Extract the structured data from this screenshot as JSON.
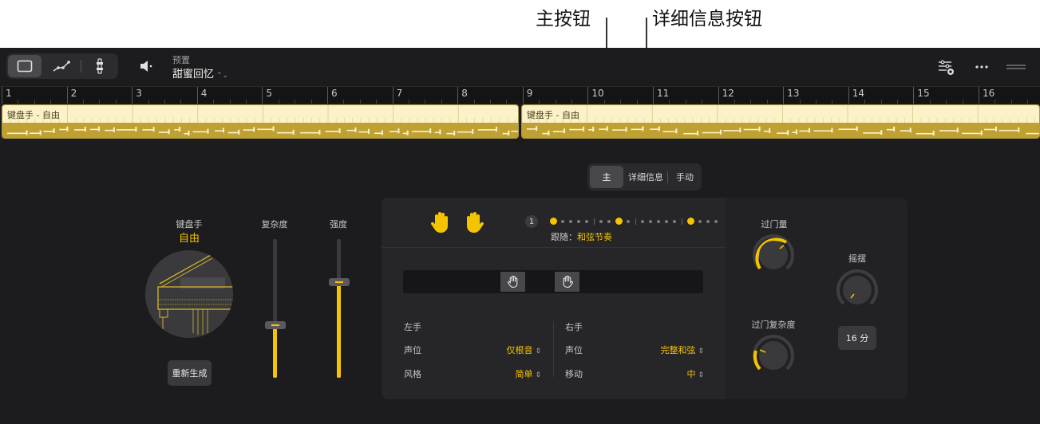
{
  "callouts": {
    "main_button": "主按钮",
    "details_button": "详细信息按钮"
  },
  "toolbar": {
    "preset_label": "预置",
    "preset_value": "甜蜜回忆",
    "view_buttons": [
      "region-view-icon",
      "automation-curve-icon",
      "smart-controls-icon"
    ],
    "right_icons": [
      "library-add-icon",
      "more-icon",
      "drag-handle-icon"
    ]
  },
  "ruler": {
    "bars": [
      "1",
      "2",
      "3",
      "4",
      "5",
      "6",
      "7",
      "8",
      "9",
      "10",
      "11",
      "12",
      "13",
      "14",
      "15",
      "16"
    ]
  },
  "regions": [
    {
      "name": "键盘手 - 自由"
    },
    {
      "name": "键盘手 - 自由"
    }
  ],
  "modes": {
    "main": "主",
    "details": "详细信息",
    "manual": "手动",
    "selected": "主"
  },
  "player": {
    "title": "键盘手",
    "style": "自由",
    "regenerate": "重新生成"
  },
  "sliders": {
    "complexity_label": "复杂度",
    "complexity_value": 0.38,
    "intensity_label": "强度",
    "intensity_value": 0.69
  },
  "performance": {
    "follow_label": "跟随：",
    "follow_value": "和弦节奏",
    "pattern_number": "1",
    "left": {
      "title": "左手",
      "voicing_label": "声位",
      "voicing_value": "仅根音",
      "style_label": "风格",
      "style_value": "简单"
    },
    "right": {
      "title": "右手",
      "voicing_label": "声位",
      "voicing_value": "完整和弦",
      "movement_label": "移动",
      "movement_value": "中"
    }
  },
  "knobs": {
    "fill_label": "过门量",
    "fill_complexity_label": "过门复杂度",
    "swing_label": "摇摆",
    "swing_value": "16 分"
  },
  "colors": {
    "accent": "#f5c400",
    "region_top": "#fbf2c8",
    "region_bottom": "#bfa032",
    "background": "#1c1c1e"
  }
}
